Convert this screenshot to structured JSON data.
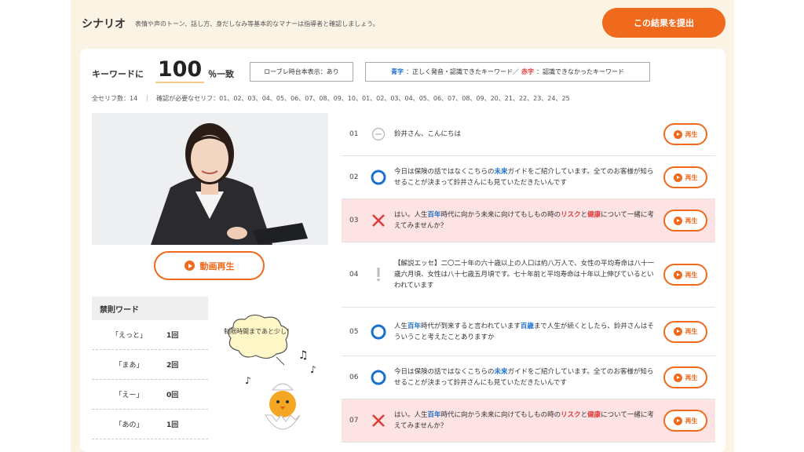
{
  "header": {
    "title": "シナリオ",
    "description": "表情や声のトーン、話し方、身だしなみ等基本的なマナーは指導者と確認しましょう。",
    "submit_label": "この結果を提出"
  },
  "keyword": {
    "label": "キーワードに",
    "value": "100",
    "unit": "％一致",
    "romaji_toggle": "ローブレ時台本表示：あり",
    "legend_blue": "青字",
    "legend_blue_text": "：正しく発音・認識できたキーワード／",
    "legend_red": "赤字",
    "legend_red_text": "：認識できなかったキーワード"
  },
  "counts_line": "全セリフ数：14　｜　確認が必要なセリフ：01、02、03、04、05、06、07、08、09、10、01、02、03、04、05、06、07、08、09、20、21、22、23、24、25",
  "movie_button": "動画再生",
  "filler": {
    "title": "禁則ワード",
    "rows": [
      {
        "word": "「えっと」",
        "count": "1回"
      },
      {
        "word": "「まあ」",
        "count": "2回"
      },
      {
        "word": "「えー」",
        "count": "0回"
      },
      {
        "word": "「あの」",
        "count": "1回"
      }
    ]
  },
  "mascot_bubble": "制限時間まであと少し！",
  "play_label": "再生",
  "lines": [
    {
      "num": "01",
      "mark": "none",
      "segments": [
        {
          "t": "鈴井さん、こんにちは",
          "c": ""
        }
      ]
    },
    {
      "num": "02",
      "mark": "ok",
      "segments": [
        {
          "t": "今日は保険の話ではなくこちらの",
          "c": ""
        },
        {
          "t": "未来",
          "c": "blue"
        },
        {
          "t": "ガイドをご紹介しています。全てのお客様が知らせることが決まって鈴井さんにも見ていただきたいんです",
          "c": ""
        }
      ]
    },
    {
      "num": "03",
      "mark": "ng",
      "segments": [
        {
          "t": "はい。人生",
          "c": ""
        },
        {
          "t": "百年",
          "c": "blue"
        },
        {
          "t": "時代に向かう未来に向けてもしもの時の",
          "c": ""
        },
        {
          "t": "リスク",
          "c": "red"
        },
        {
          "t": "と",
          "c": ""
        },
        {
          "t": "健康",
          "c": "red"
        },
        {
          "t": "について一緒に考えてみませんか？",
          "c": ""
        }
      ]
    },
    {
      "num": "04",
      "mark": "warn",
      "segments": [
        {
          "t": "【解説エッセ】二〇二十年の六十歳以上の人口は約八万人で、女性の平均寿命は八十一歳六月頃、女性は八十七歳五月頃です。七十年前と平均寿命は十年以上伸びているといわれています",
          "c": "gray"
        }
      ]
    },
    {
      "num": "05",
      "mark": "ok",
      "segments": [
        {
          "t": "人生",
          "c": ""
        },
        {
          "t": "百年",
          "c": "blue"
        },
        {
          "t": "時代が到来すると言われています",
          "c": ""
        },
        {
          "t": "百歳",
          "c": "blue"
        },
        {
          "t": "まで人生が続くとしたら、鈴井さんはそういうこと考えたことありますか",
          "c": ""
        }
      ]
    },
    {
      "num": "06",
      "mark": "ok",
      "segments": [
        {
          "t": "今日は保険の話ではなくこちらの",
          "c": ""
        },
        {
          "t": "未来",
          "c": "blue"
        },
        {
          "t": "ガイドをご紹介しています。全てのお客様が知らせることが決まって鈴井さんにも見ていただきたいんです",
          "c": ""
        }
      ]
    },
    {
      "num": "07",
      "mark": "ng",
      "segments": [
        {
          "t": "はい。人生",
          "c": ""
        },
        {
          "t": "百年",
          "c": "blue"
        },
        {
          "t": "時代に向かう未来に向けてもしもの時の",
          "c": ""
        },
        {
          "t": "リスク",
          "c": "red"
        },
        {
          "t": "と",
          "c": ""
        },
        {
          "t": "健康",
          "c": "red"
        },
        {
          "t": "について一緒に考えてみませんか？",
          "c": ""
        }
      ]
    }
  ]
}
